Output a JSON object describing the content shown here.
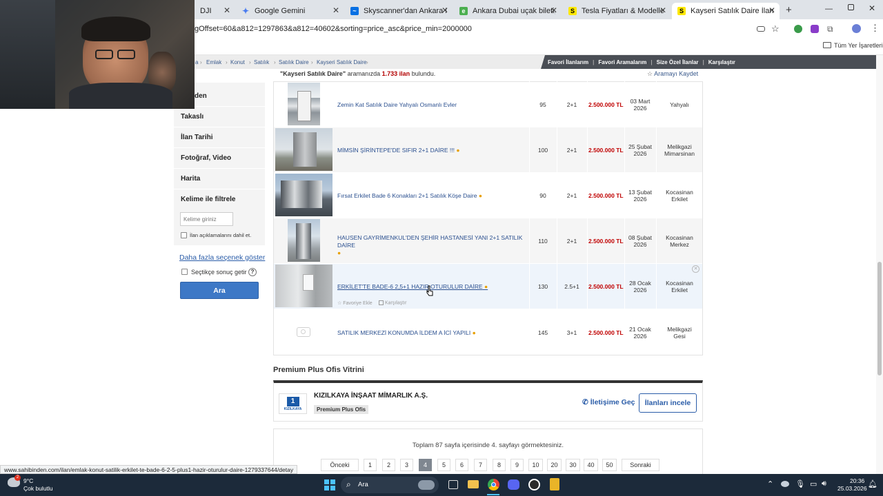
{
  "browser": {
    "tabs": [
      {
        "title": "DJI",
        "favicon": "dji-icon",
        "color": "#000000"
      },
      {
        "title": "Google Gemini",
        "favicon": "gemini-icon",
        "color": "#4a7cf0"
      },
      {
        "title": "Skyscanner'dan Ankara Esenbo",
        "favicon": "skyscanner-icon",
        "color": "#0770e3"
      },
      {
        "title": "Ankara Dubai uçak bileti, Ucuz",
        "favicon": "enuygun-icon",
        "color": "#4caf50"
      },
      {
        "title": "Tesla Fiyatları & Modelleri sahi",
        "favicon": "sahibinden-icon",
        "color": "#ffe800"
      },
      {
        "title": "Kayseri Satılık Daire İlanları ve",
        "favicon": "sahibinden-icon",
        "color": "#ffe800"
      }
    ],
    "url": "gOffset=60&a812=1297863&a812=40602&sorting=price_asc&price_min=2000000",
    "bookmarks_label": "Tüm Yer İşaretleri",
    "status_url": "www.sahibinden.com/ilan/emlak-konut-satilik-erkilet-te-bade-6-2-5-plus1-hazir-oturulur-daire-1279337644/detay"
  },
  "breadcrumb": [
    "a",
    "Emlak",
    "Konut",
    "Satılık",
    "Satılık Daire",
    "Kayseri Satılık Daire"
  ],
  "top_links": [
    "Favori İlanlarım",
    "Favori Aramalarım",
    "Size Özel İlanlar",
    "Karşılaştır"
  ],
  "result": {
    "query": "\"Kayseri Satılık Daire\"",
    "middle": "aramanızda",
    "count": "1.733 ilan",
    "suffix": "bulundu.",
    "save_search": "Aramayı Kaydet"
  },
  "sidebar": {
    "items": [
      "den",
      "Takaslı",
      "İlan Tarihi",
      "Fotoğraf, Video",
      "Harita",
      "Kelime ile filtrele"
    ],
    "keyword_placeholder": "Kelime giriniz",
    "include_desc": "İlan açıklamalarını dahil et.",
    "more_options": "Daha fazla seçenek göster",
    "select_results": "Seçtikçe sonuç getir",
    "help": "?",
    "search_button": "Ara"
  },
  "listings": [
    {
      "title": "Zemin Kat Satılık Daire Yahyalı Osmanlı Evler",
      "m2": "95",
      "rooms": "2+1",
      "price": "2.500.000 TL",
      "date1": "03 Mart",
      "date2": "2026",
      "loc1": "Yahyalı",
      "loc2": ""
    },
    {
      "title": "MİMSİN ŞİRİNTEPE'DE SIFIR 2+1 DAİRE !!!",
      "m2": "100",
      "rooms": "2+1",
      "price": "2.500.000 TL",
      "date1": "25 Şubat",
      "date2": "2026",
      "loc1": "Melikgazi",
      "loc2": "Mimarsinan"
    },
    {
      "title": "Fırsat Erkilet Bade 6 Konakları 2+1 Satılık Köşe Daire",
      "m2": "90",
      "rooms": "2+1",
      "price": "2.500.000 TL",
      "date1": "13 Şubat",
      "date2": "2026",
      "loc1": "Kocasinan",
      "loc2": "Erkilet"
    },
    {
      "title": "HAUSEN GAYRİMENKUL'DEN ŞEHİR HASTANESİ YANI 2+1 SATILIK DAİRE",
      "m2": "110",
      "rooms": "2+1",
      "price": "2.500.000 TL",
      "date1": "08 Şubat",
      "date2": "2026",
      "loc1": "Kocasinan",
      "loc2": "Merkez"
    },
    {
      "title": "ERKİLET'TE BADE-6 2,5+1 HAZIR OTURULUR DAİRE",
      "m2": "130",
      "rooms": "2.5+1",
      "price": "2.500.000 TL",
      "date1": "28 Ocak",
      "date2": "2026",
      "loc1": "Kocasinan",
      "loc2": "Erkilet"
    },
    {
      "title": "SATILIK MERKEZİ KONUMDA İLDEM A İCİ YAPILI",
      "m2": "145",
      "rooms": "3+1",
      "price": "2.500.000 TL",
      "date1": "21 Ocak",
      "date2": "2026",
      "loc1": "Melikgazi",
      "loc2": "Gesi"
    }
  ],
  "hover_actions": {
    "fav": "Favoriye Ekle",
    "compare": "Karşılaştır"
  },
  "premium": {
    "heading": "Premium Plus Ofis Vitrini",
    "logo_num": "1",
    "logo_text": "KIZILKAYA",
    "name": "KIZILKAYA İNŞAAT MİMARLIK A.Ş.",
    "badge": "Premium Plus Ofis",
    "contact": "İletişime Geç",
    "view": "İlanları incele"
  },
  "pagination": {
    "info": "Toplam 87 sayfa içerisinde 4. sayfayı görmektesiniz.",
    "prev": "Önceki",
    "pages": [
      "1",
      "2",
      "3",
      "4",
      "5",
      "6",
      "7",
      "8",
      "9",
      "10",
      "20",
      "30",
      "40",
      "50"
    ],
    "current": "4",
    "next": "Sonraki"
  },
  "taskbar": {
    "temp": "9°C",
    "weather": "Çok bulutlu",
    "search": "Ara",
    "time": "20:36",
    "date": "25.03.2026",
    "badge": "2"
  }
}
